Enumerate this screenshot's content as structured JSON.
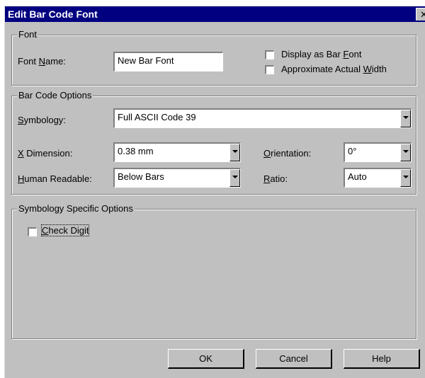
{
  "window": {
    "title": "Edit Bar Code Font",
    "close_label": "✕"
  },
  "font_group": {
    "legend": "Font",
    "font_name_label_pre": "Font ",
    "font_name_label_key": "N",
    "font_name_label_post": "ame:",
    "font_name_value": "New Bar Font",
    "display_as_bar_font_pre": "Display as Bar ",
    "display_as_bar_font_key": "F",
    "display_as_bar_font_post": "ont",
    "display_as_bar_font_checked": false,
    "approx_width_pre": "Approximate Actual ",
    "approx_width_key": "W",
    "approx_width_post": "idth",
    "approx_width_checked": false
  },
  "barcode_group": {
    "legend": "Bar Code Options",
    "symbology_key": "S",
    "symbology_post": "ymbology:",
    "symbology_value": "Full ASCII Code 39",
    "xdim_key": "X",
    "xdim_post": " Dimension:",
    "xdim_value": "0.38 mm",
    "orientation_key": "O",
    "orientation_post": "rientation:",
    "orientation_value": "0°",
    "human_key": "H",
    "human_post": "uman Readable:",
    "human_value": "Below Bars",
    "ratio_key": "R",
    "ratio_post": "atio:",
    "ratio_value": "Auto"
  },
  "specific_group": {
    "legend": "Symbology Specific Options",
    "check_digit_key": "C",
    "check_digit_post": "heck Digit",
    "check_digit_checked": false
  },
  "buttons": {
    "ok": "OK",
    "cancel": "Cancel",
    "help": "Help"
  }
}
